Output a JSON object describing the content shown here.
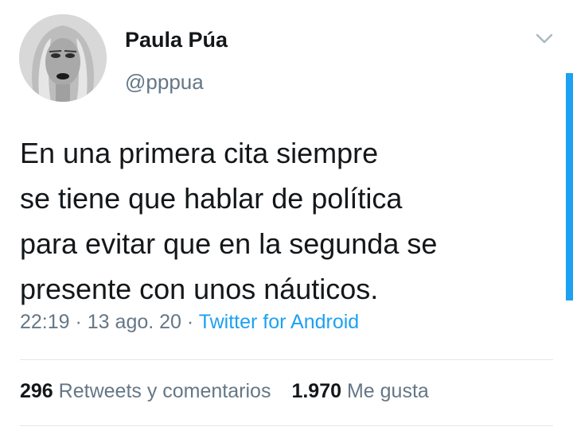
{
  "user": {
    "display_name": "Paula Púa",
    "handle": "@pppua"
  },
  "tweet": {
    "lines": [
      "En una primera cita siempre",
      "se tiene que hablar de política",
      "para evitar que en la segunda se",
      "presente con unos náuticos."
    ],
    "time": "22:19",
    "separator": " · ",
    "date": "13 ago. 20",
    "source": "Twitter for Android"
  },
  "stats": {
    "retweets_count": "296",
    "retweets_label": "Retweets y comentarios",
    "likes_count": "1.970",
    "likes_label": "Me gusta"
  },
  "icons": {
    "menu": "chevron-down-icon"
  },
  "colors": {
    "text": "#14171a",
    "secondary": "#657786",
    "accent": "#1da1f2",
    "divider": "#e1e8ed"
  }
}
